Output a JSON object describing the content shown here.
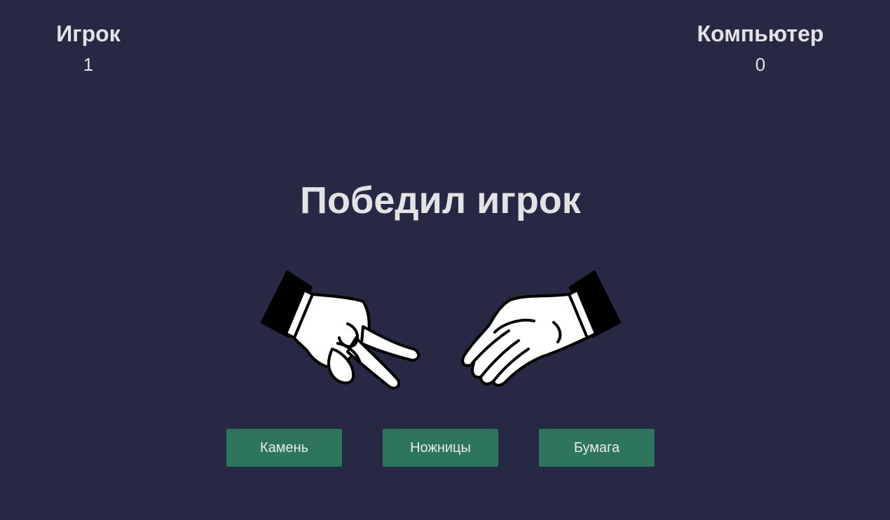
{
  "scoreboard": {
    "player": {
      "label": "Игрок",
      "score": "1"
    },
    "computer": {
      "label": "Компьютер",
      "score": "0"
    }
  },
  "result_text": "Победил игрок",
  "hands": {
    "player": "scissors-hand-icon",
    "computer": "paper-hand-icon"
  },
  "buttons": {
    "rock": "Камень",
    "scissors": "Ножницы",
    "paper": "Бумага"
  },
  "colors": {
    "background": "#272844",
    "text": "#e3e3e6",
    "button": "#2e755e"
  }
}
